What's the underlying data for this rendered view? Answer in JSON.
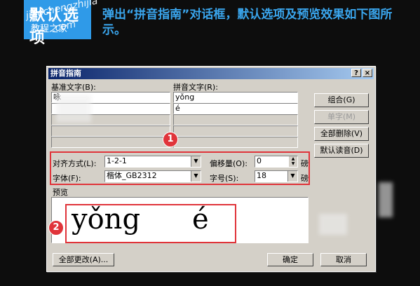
{
  "banner": {
    "badge_title": "默认选项",
    "wm_line1": "jiaochengzhijia",
    "wm_line2": ".com",
    "wm_line3": "教程之家",
    "headline": "弹出“拼音指南”对话框，默认选项及预览效果如下图所示。"
  },
  "dialog": {
    "title": "拼音指南",
    "help_btn": "?",
    "close_btn": "×",
    "base_text_label": "基准文字(B):",
    "ruby_text_label": "拼音文字(R):",
    "base_rows": [
      "咏",
      "",
      "",
      "",
      ""
    ],
    "ruby_rows": [
      "yǒng",
      "é",
      "",
      "",
      ""
    ],
    "buttons": {
      "group": "组合(G)",
      "single": "单字(M)",
      "delete_all": "全部删除(V)",
      "default_reading": "默认读音(D)",
      "change_all": "全部更改(A)...",
      "ok": "确定",
      "cancel": "取消"
    },
    "align_label": "对齐方式(L):",
    "align_value": "1-2-1",
    "offset_label": "偏移量(O):",
    "offset_value": "0",
    "offset_unit": "磅",
    "font_label": "字体(F):",
    "font_value": "楷体_GB2312",
    "size_label": "字号(S):",
    "size_value": "18",
    "size_unit": "磅",
    "preview_label": "预览",
    "preview_syllables": [
      "yǒng",
      "é"
    ]
  },
  "annotations": {
    "marker1": "1",
    "marker2": "2"
  },
  "colors": {
    "headline": "#3aa6ee",
    "badge": "#2f9ae8",
    "highlight": "#e0343a",
    "titlebar": "#0a246a"
  }
}
